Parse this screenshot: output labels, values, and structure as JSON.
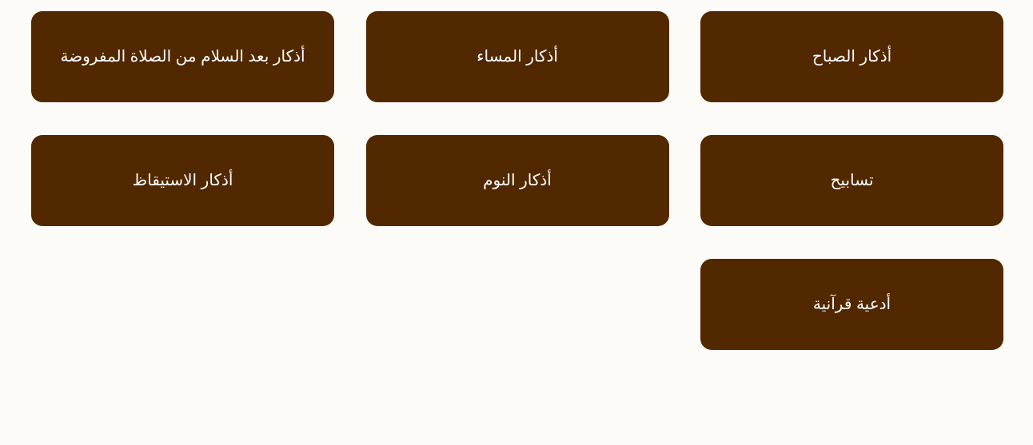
{
  "cards": [
    {
      "label": "أذكار الصباح"
    },
    {
      "label": "أذكار المساء"
    },
    {
      "label": "أذكار بعد السلام من الصلاة المفروضة"
    },
    {
      "label": "تسابيح"
    },
    {
      "label": "أذكار النوم"
    },
    {
      "label": "أذكار الاستيقاظ"
    },
    {
      "label": "أدعية قرآنية"
    }
  ],
  "colors": {
    "background": "#fcfbf7",
    "card": "#522800",
    "text": "#ffffff"
  }
}
